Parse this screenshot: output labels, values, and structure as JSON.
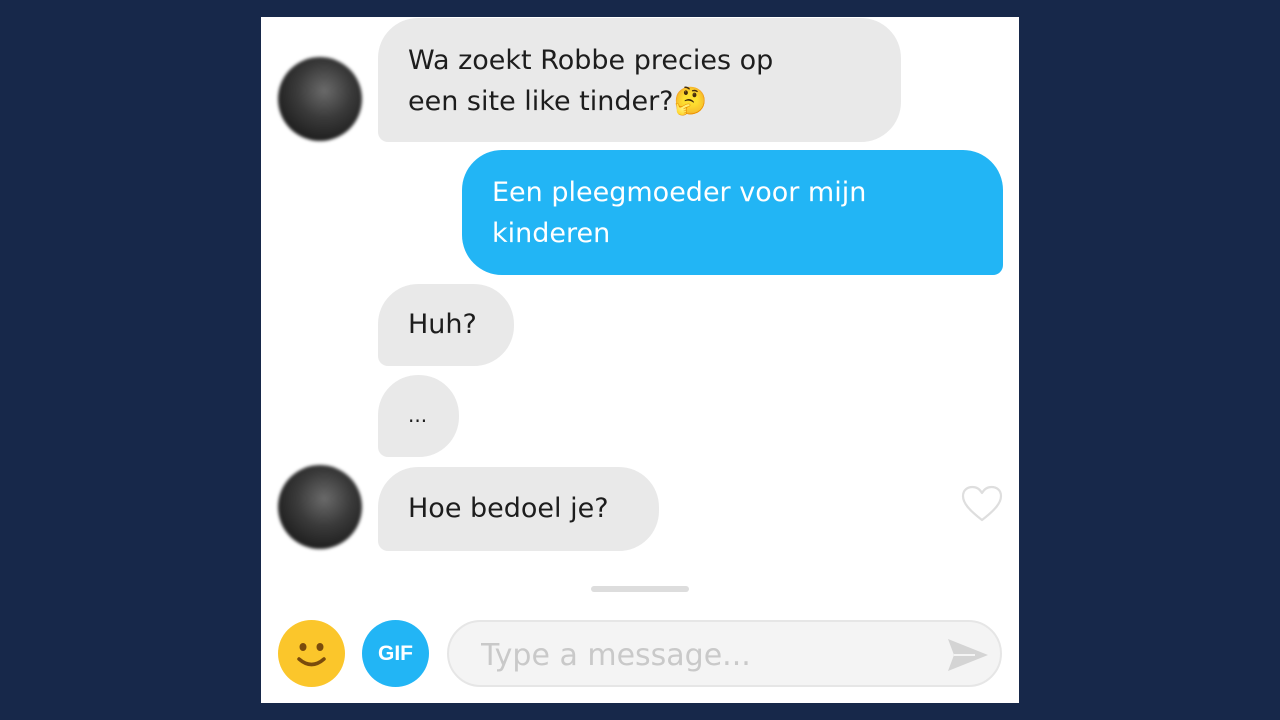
{
  "messages": [
    {
      "direction": "in",
      "lines": [
        "Wa zoekt Robbe precies op",
        "een site like tinder?🤔"
      ]
    },
    {
      "direction": "out",
      "lines": [
        "Een pleegmoeder voor mijn",
        "kinderen"
      ]
    },
    {
      "direction": "in",
      "lines": [
        "Huh?"
      ]
    },
    {
      "direction": "in",
      "lines": [
        "..."
      ]
    },
    {
      "direction": "in",
      "lines": [
        "Hoe bedoel je?"
      ]
    }
  ],
  "composer": {
    "gif_label": "GIF",
    "placeholder": "Type a message..."
  },
  "icons": {
    "avatar": "contact-avatar",
    "like": "heart-outline-icon",
    "emoji": "smiley-icon",
    "send": "send-arrow-icon"
  },
  "colors": {
    "background": "#17284a",
    "incoming_bubble": "#e9e9e9",
    "outgoing_bubble": "#22b5f5",
    "emoji_button": "#fbc62b",
    "gif_button": "#22b5f5"
  }
}
